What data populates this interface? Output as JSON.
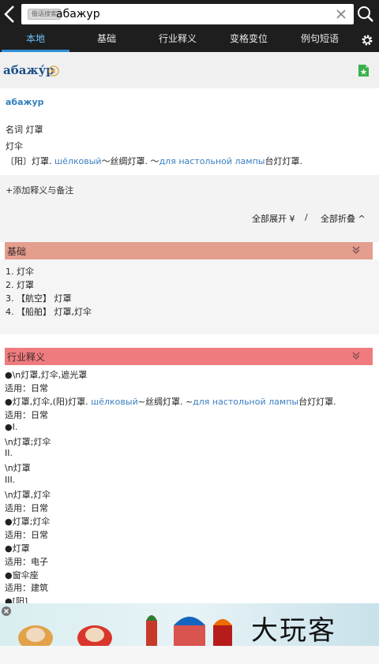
{
  "search": {
    "mode_chip": "俄语搜索",
    "query": "абажур"
  },
  "tabs": [
    "本地",
    "基础",
    "行业释义",
    "变格变位",
    "例句短语"
  ],
  "entry": {
    "headword": "абажу́р",
    "word": "абажур",
    "pos_line": "名词 灯罩",
    "alt_line": "灯伞",
    "example": {
      "prefix": "〔阳〕灯罩. ",
      "link1": "шёлковый",
      "mid": "～丝绸灯罩. ～",
      "link2": "для настольной лампы",
      "suffix": "台灯灯罩."
    }
  },
  "add_note": "+添加释义与备注",
  "expand_all": "全部展开",
  "separator": "/",
  "collapse_all": "全部折叠",
  "basic": {
    "title": "基础",
    "items": [
      "1. 灯伞",
      "2. 灯罩",
      "3. 【航空】 灯罩",
      "4. 【船舶】 灯罩,灯伞"
    ]
  },
  "industry": {
    "title": "行业释义",
    "lines": [
      "●\\n灯罩,灯伞,遮光罩",
      "适用：日常",
      "__EXAMPLE__",
      "适用：日常",
      "●I.",
      "\\n灯罩;灯伞",
      "II.",
      "\\n灯罩",
      "III.",
      "\\n灯罩,灯伞",
      "适用：日常",
      "●灯罩;灯伞",
      "适用：日常",
      "●灯罩",
      "适用：电子",
      "●窗伞座",
      "适用：建筑",
      "●[阳]"
    ],
    "example": {
      "prefix": "●灯罩,灯伞,(阳)灯罩. ",
      "link1": "шёлковый",
      "mid": "~丝绸灯罩. ~",
      "link2": "для настольной лампы",
      "suffix": "台灯灯罩."
    }
  },
  "ad": {
    "brand": "大玩客"
  },
  "colors": {
    "basic_header": "#e39e8e",
    "industry_header": "#f07b7e",
    "accent": "#2f8fd8",
    "link": "#3a7fc0"
  }
}
